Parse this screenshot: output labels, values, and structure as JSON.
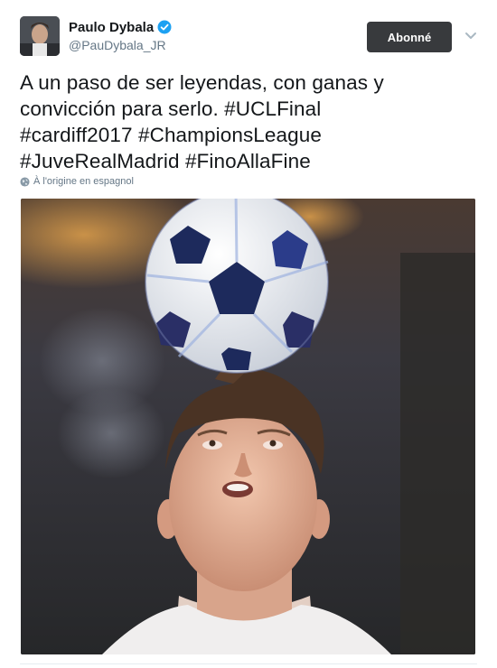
{
  "user": {
    "display_name": "Paulo Dybala",
    "handle": "@PauDybala_JR",
    "verified": true
  },
  "actions": {
    "follow_label": "Abonné"
  },
  "tweet": {
    "text_lines": [
      "A un paso de ser leyendas, con ganas y",
      "convicción para serlo. #UCLFinal",
      "#cardiff2017 #ChampionsLeague",
      "#JuveRealMadrid #FinoAllaFine"
    ],
    "translation_label": "À l'origine en espagnol"
  },
  "icons": {
    "verified": "verified-badge-icon",
    "menu": "chevron-down-icon",
    "language": "globe-icon"
  },
  "colors": {
    "verified": "#1da1f2",
    "follow_button": "#383a3d",
    "secondary_text": "#657786"
  }
}
